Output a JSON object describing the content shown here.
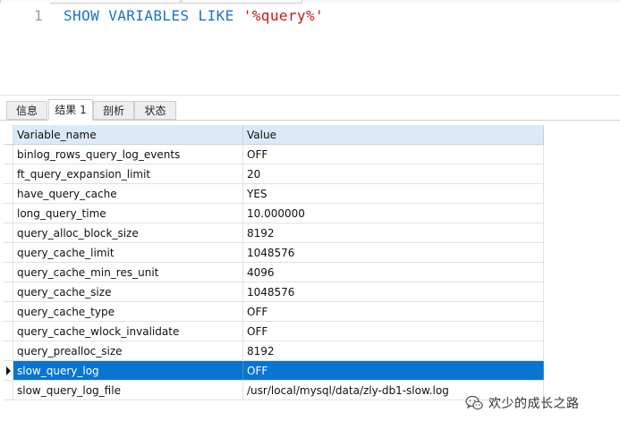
{
  "editor": {
    "line_number": "1",
    "code": {
      "keyword_1": "SHOW",
      "keyword_2": "VARIABLES",
      "keyword_3": "LIKE",
      "string_literal": "'%query%'"
    },
    "colors": {
      "keyword": "#1b73c9",
      "string": "#c41a16",
      "line_number": "#9a9a9a"
    }
  },
  "result_tabs": [
    {
      "label": "信息",
      "active": false
    },
    {
      "label": "结果 1",
      "active": true
    },
    {
      "label": "剖析",
      "active": false
    },
    {
      "label": "状态",
      "active": false
    }
  ],
  "grid": {
    "columns": [
      "Variable_name",
      "Value"
    ],
    "rows": [
      [
        "binlog_rows_query_log_events",
        "OFF"
      ],
      [
        "ft_query_expansion_limit",
        "20"
      ],
      [
        "have_query_cache",
        "YES"
      ],
      [
        "long_query_time",
        "10.000000"
      ],
      [
        "query_alloc_block_size",
        "8192"
      ],
      [
        "query_cache_limit",
        "1048576"
      ],
      [
        "query_cache_min_res_unit",
        "4096"
      ],
      [
        "query_cache_size",
        "1048576"
      ],
      [
        "query_cache_type",
        "OFF"
      ],
      [
        "query_cache_wlock_invalidate",
        "OFF"
      ],
      [
        "query_prealloc_size",
        "8192"
      ],
      [
        "slow_query_log",
        "OFF"
      ],
      [
        "slow_query_log_file",
        "/usr/local/mysql/data/zly-db1-slow.log"
      ]
    ],
    "selected_row_index": 11,
    "colors": {
      "header_bg": "#dce9f7",
      "selection_bg": "#0a75d0"
    }
  },
  "watermark": {
    "text": "欢少的成长之路",
    "icon": "wechat-icon"
  }
}
